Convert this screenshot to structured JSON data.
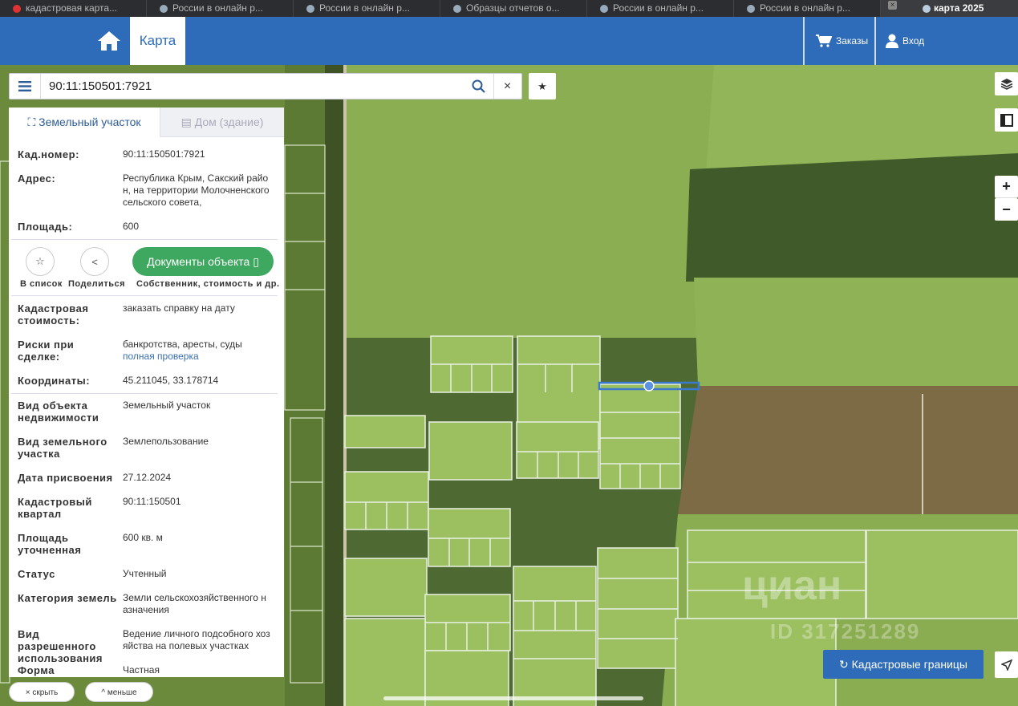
{
  "browser_tabs": [
    {
      "title": "кадастровая карта..."
    },
    {
      "title": "России в онлайн р..."
    },
    {
      "title": "России в онлайн р..."
    },
    {
      "title": "Образцы отчетов о..."
    },
    {
      "title": "России в онлайн р..."
    },
    {
      "title": "России в онлайн р..."
    },
    {
      "title": "карта 2025",
      "active": true
    }
  ],
  "header": {
    "map_tab": "Карта",
    "orders": "Заказы",
    "login": "Вход",
    "brand_color": "#2e6bb8"
  },
  "search": {
    "value": "90:11:150501:7921",
    "clear_glyph": "×"
  },
  "panel": {
    "tabs": [
      "Земельный участок",
      "Дом (здание)"
    ],
    "cad_number_label": "Кад.номер:",
    "cad_number": "90:11:150501:7921",
    "address_label": "Адрес:",
    "address": "Республика Крым, Сакский райо н, на территории Молочненского сельского совета,",
    "area_label": "Площадь:",
    "area": "600",
    "actions": {
      "to_list": "В список",
      "share": "Поделиться",
      "docs_button": "Документы объекта",
      "docs_sub": "Собственник, стоимость и др."
    },
    "cad_cost_label": "Кадастровая стоимость:",
    "cad_cost_link": "заказать справку на дату",
    "risks_label": "Риски при сделке:",
    "risks_text": "банкротства, аресты, суды",
    "risks_link": "полная проверка",
    "coords_label": "Координаты:",
    "coords": "45.211045, 33.178714",
    "details": [
      {
        "label": "Вид объекта недвижимости",
        "value": "Земельный участок"
      },
      {
        "label": "Вид земельного участка",
        "value": "Землепользование"
      },
      {
        "label": "Дата присвоения",
        "value": "27.12.2024"
      },
      {
        "label": "Кадастровый квартал",
        "value": "90:11:150501"
      },
      {
        "label": "Площадь уточненная",
        "value": "600 кв. м"
      },
      {
        "label": "Статус",
        "value": "Учтенный"
      },
      {
        "label": "Категория земель",
        "value": "Земли сельскохозяйственного н азначения"
      },
      {
        "label": "Вид разрешенного использования",
        "value": "Ведение личного подсобного хоз яйства на полевых участках"
      },
      {
        "label": "Форма",
        "value": "Частная"
      }
    ]
  },
  "bottom": {
    "hide": "скрыть",
    "less": "меньше"
  },
  "map_controls": {
    "zoom_in": "+",
    "zoom_out": "−",
    "cadastral_borders": "Кадастровые границы"
  },
  "watermark": {
    "brand": "циан",
    "id": "ID 317251289"
  }
}
